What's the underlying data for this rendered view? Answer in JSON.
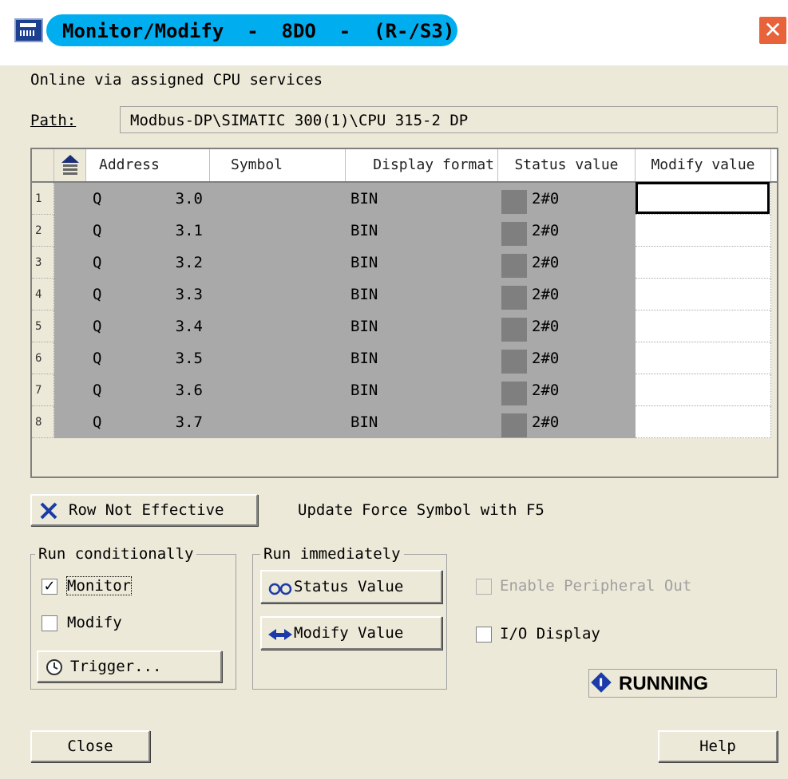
{
  "window": {
    "title": "Monitor/Modify  -  8DO  -  (R-/S3)",
    "close_glyph": "✕",
    "accent_color": "#00aef0"
  },
  "info": {
    "online_text": "Online via assigned CPU services",
    "path_label": "Path:",
    "path_value": "Modbus-DP\\SIMATIC 300(1)\\CPU 315-2 DP"
  },
  "table": {
    "columns": [
      "Address",
      "Symbol",
      "Display format",
      "Status value",
      "Modify value"
    ],
    "rows": [
      {
        "num": "1",
        "area": "Q",
        "addr": "3.0",
        "symbol": "",
        "format": "BIN",
        "status": "2#0",
        "modify": ""
      },
      {
        "num": "2",
        "area": "Q",
        "addr": "3.1",
        "symbol": "",
        "format": "BIN",
        "status": "2#0",
        "modify": ""
      },
      {
        "num": "3",
        "area": "Q",
        "addr": "3.2",
        "symbol": "",
        "format": "BIN",
        "status": "2#0",
        "modify": ""
      },
      {
        "num": "4",
        "area": "Q",
        "addr": "3.3",
        "symbol": "",
        "format": "BIN",
        "status": "2#0",
        "modify": ""
      },
      {
        "num": "5",
        "area": "Q",
        "addr": "3.4",
        "symbol": "",
        "format": "BIN",
        "status": "2#0",
        "modify": ""
      },
      {
        "num": "6",
        "area": "Q",
        "addr": "3.5",
        "symbol": "",
        "format": "BIN",
        "status": "2#0",
        "modify": ""
      },
      {
        "num": "7",
        "area": "Q",
        "addr": "3.6",
        "symbol": "",
        "format": "BIN",
        "status": "2#0",
        "modify": ""
      },
      {
        "num": "8",
        "area": "Q",
        "addr": "3.7",
        "symbol": "",
        "format": "BIN",
        "status": "2#0",
        "modify": ""
      }
    ]
  },
  "controls": {
    "row_not_effective": "Row Not Effective",
    "hint_text": "Update Force Symbol with F5",
    "run_conditionally": {
      "title": "Run conditionally",
      "monitor_label": "Monitor",
      "monitor_checked": true,
      "modify_label": "Modify",
      "modify_checked": false,
      "trigger_label": "Trigger..."
    },
    "run_immediately": {
      "title": "Run immediately",
      "status_value_label": "Status Value",
      "modify_value_label": "Modify Value"
    },
    "enable_peripheral_label": "Enable Peripheral Out",
    "io_display_label": "I/O Display",
    "running_status": "RUNNING"
  },
  "footer": {
    "close_label": "Close",
    "help_label": "Help"
  }
}
